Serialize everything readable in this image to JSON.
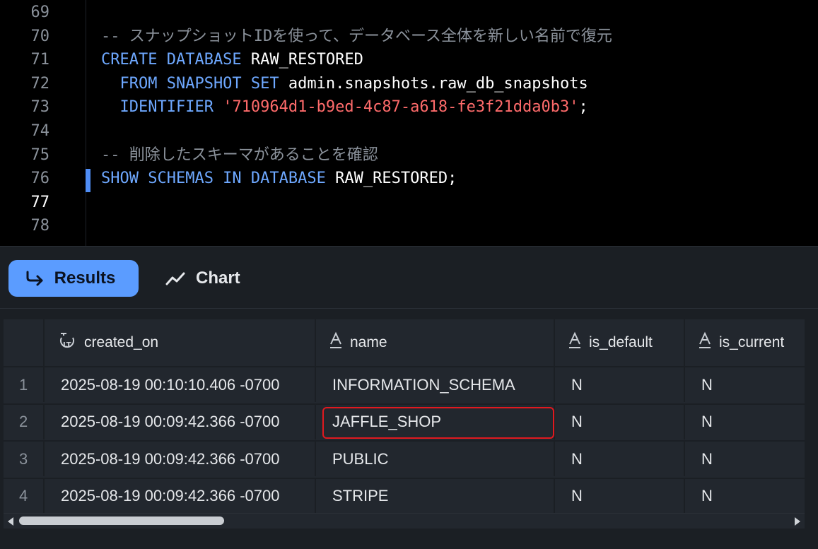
{
  "editor": {
    "line_numbers": [
      "69",
      "70",
      "71",
      "72",
      "73",
      "74",
      "75",
      "76",
      "77",
      "78"
    ],
    "active_line": "77",
    "lines": [
      {
        "num": "70",
        "parts": [
          {
            "t": "-- スナップショットIDを使って、データベース全体を新しい名前で復元",
            "c": "cm"
          }
        ]
      },
      {
        "num": "71",
        "parts": [
          {
            "t": "CREATE DATABASE",
            "c": "kw"
          },
          {
            "t": " RAW_RESTORED",
            "c": "id"
          }
        ]
      },
      {
        "num": "72",
        "parts": [
          {
            "t": "  FROM SNAPSHOT SET",
            "c": "kw"
          },
          {
            "t": " admin.snapshots.raw_db_snapshots",
            "c": "id"
          }
        ]
      },
      {
        "num": "73",
        "parts": [
          {
            "t": "  IDENTIFIER",
            "c": "kw"
          },
          {
            "t": " '710964d1-b9ed-4c87-a618-fe3f21dda0b3'",
            "c": "str"
          },
          {
            "t": ";",
            "c": "id"
          }
        ]
      },
      {
        "num": "75",
        "parts": [
          {
            "t": "-- 削除したスキーマがあることを確認",
            "c": "cm"
          }
        ]
      },
      {
        "num": "76",
        "parts": [
          {
            "t": "SHOW SCHEMAS IN DATABASE",
            "c": "kw"
          },
          {
            "t": " RAW_RESTORED;",
            "c": "id"
          }
        ]
      }
    ]
  },
  "tabs": {
    "results_label": "Results",
    "chart_label": "Chart",
    "active": "Results",
    "results_icon": "corner-down-right-arrow-icon",
    "chart_icon": "line-chart-icon"
  },
  "table": {
    "columns": [
      {
        "label": "created_on",
        "icon": "timestamp-type-icon"
      },
      {
        "label": "name",
        "icon": "text-type-icon"
      },
      {
        "label": "is_default",
        "icon": "text-type-icon"
      },
      {
        "label": "is_current",
        "icon": "text-type-icon"
      }
    ],
    "rows": [
      {
        "idx": "1",
        "created_on": "2025-08-19 00:10:10.406 -0700",
        "name": "INFORMATION_SCHEMA",
        "is_default": "N",
        "is_current": "N"
      },
      {
        "idx": "2",
        "created_on": "2025-08-19 00:09:42.366 -0700",
        "name": "JAFFLE_SHOP",
        "is_default": "N",
        "is_current": "N"
      },
      {
        "idx": "3",
        "created_on": "2025-08-19 00:09:42.366 -0700",
        "name": "PUBLIC",
        "is_default": "N",
        "is_current": "N"
      },
      {
        "idx": "4",
        "created_on": "2025-08-19 00:09:42.366 -0700",
        "name": "STRIPE",
        "is_default": "N",
        "is_current": "N"
      }
    ],
    "highlighted_cell": {
      "row": "2",
      "column": "name"
    }
  },
  "colors": {
    "keyword": "#6ea8ff",
    "string": "#ff6b6b",
    "comment": "#8b929b",
    "active_tab": "#5b9cff",
    "highlight_border": "#e0191f"
  }
}
